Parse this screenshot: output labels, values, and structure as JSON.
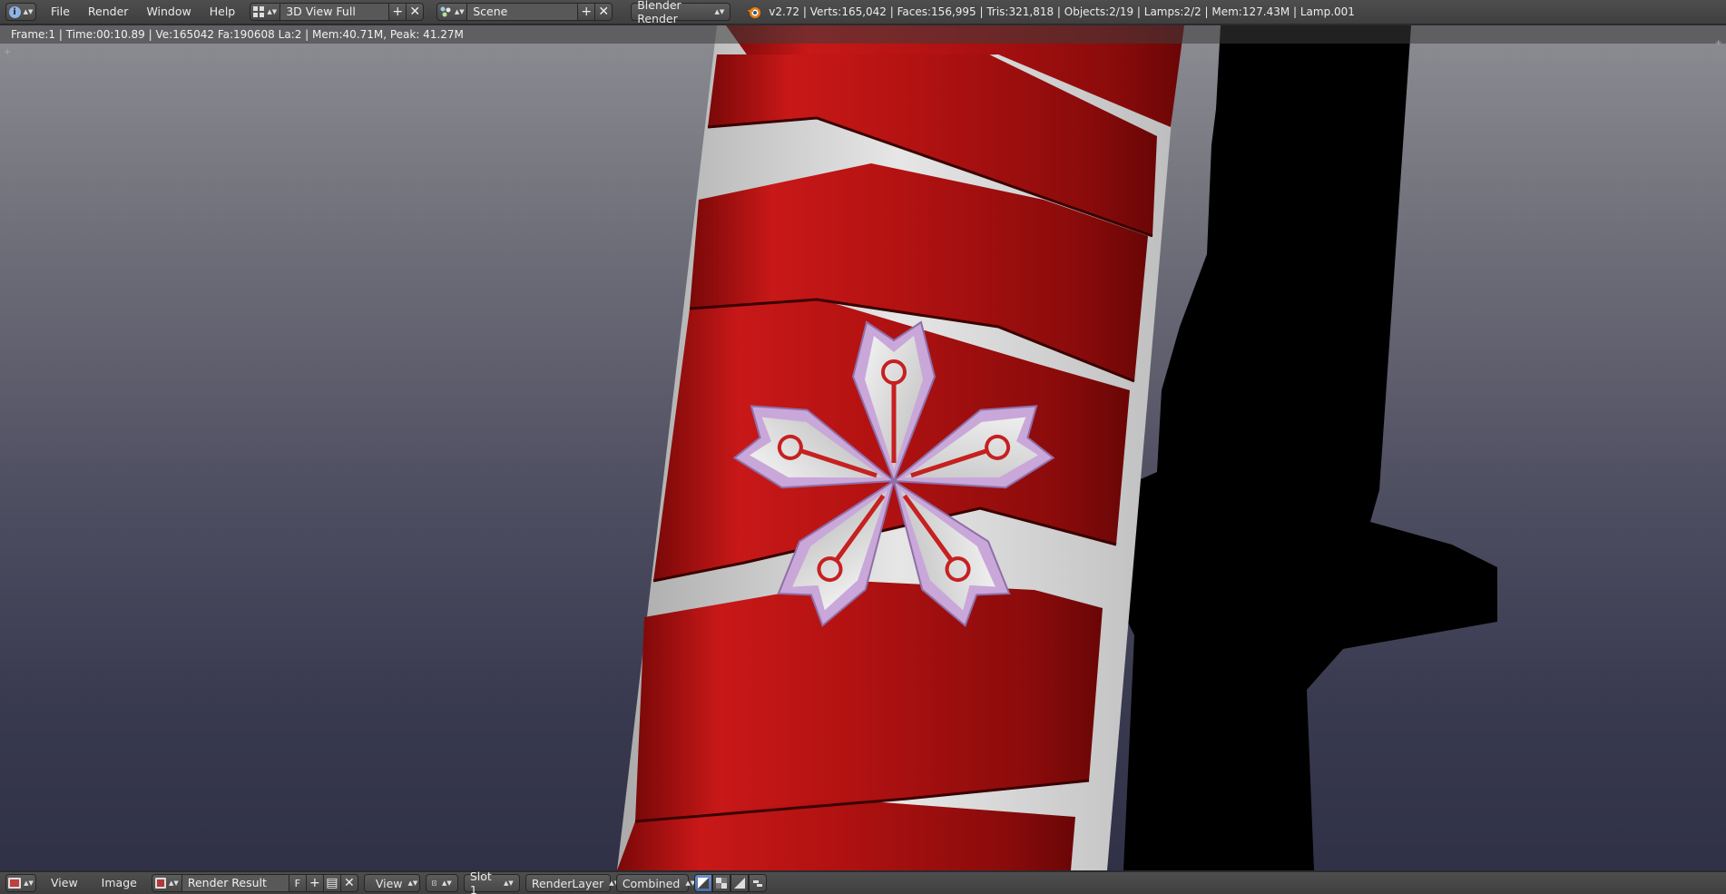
{
  "top_header": {
    "menu": [
      "File",
      "Render",
      "Window",
      "Help"
    ],
    "screen_layout": "3D View Full",
    "scene": "Scene",
    "render_engine": "Blender Render",
    "stats": "v2.72 | Verts:165,042 | Faces:156,995 | Tris:321,818 | Objects:2/19 | Lamps:2/2 | Mem:127.43M | Lamp.001"
  },
  "image_editor": {
    "render_info": "Frame:1 | Time:00:10.89 | Ve:165042 Fa:190608 La:2 | Mem:40.71M, Peak: 41.27M"
  },
  "bottom_header": {
    "menu": [
      "View",
      "Image"
    ],
    "image_name": "Render Result",
    "fake_user": "F",
    "view_mode": "View",
    "slot": "Slot 1",
    "render_layer": "RenderLayer",
    "render_pass": "Combined"
  },
  "icons": {
    "editor_info": "info-icon",
    "screen_layout": "screen-layout-icon",
    "scene": "scene-icon",
    "engine_logo": "blender-logo-icon",
    "image_editor": "image-editor-icon"
  },
  "colors": {
    "header_bg": "#454545",
    "wrap_red": "#b01515",
    "emblem_lavender": "#c8a8d8",
    "shadow": "#000000",
    "active_blue": "#5a7fc0"
  }
}
